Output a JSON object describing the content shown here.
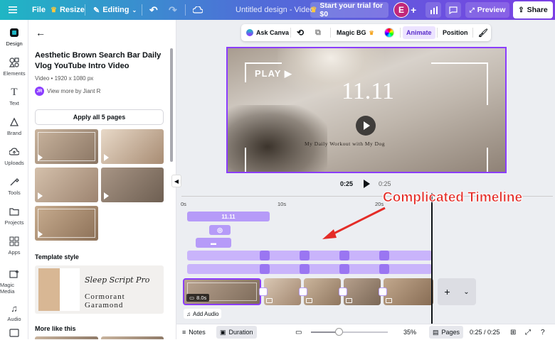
{
  "topbar": {
    "file": "File",
    "resize": "Resize",
    "editing": "Editing",
    "doc_title": "Untitled design - Video",
    "trial": "Start your trial for $0",
    "avatar_initial": "E",
    "preview": "Preview",
    "share": "Share"
  },
  "rail": {
    "items": [
      {
        "label": "Design",
        "icon": "design-icon"
      },
      {
        "label": "Elements",
        "icon": "elements-icon"
      },
      {
        "label": "Text",
        "icon": "text-icon"
      },
      {
        "label": "Brand",
        "icon": "brand-icon"
      },
      {
        "label": "Uploads",
        "icon": "uploads-icon"
      },
      {
        "label": "Tools",
        "icon": "tools-icon"
      },
      {
        "label": "Projects",
        "icon": "projects-icon"
      },
      {
        "label": "Apps",
        "icon": "apps-icon"
      },
      {
        "label": "Magic Media",
        "icon": "magic-media-icon"
      },
      {
        "label": "Audio",
        "icon": "audio-icon"
      },
      {
        "label": "Videos",
        "icon": "videos-icon"
      }
    ]
  },
  "panel": {
    "title": "Aesthetic Brown Search Bar Daily Vlog YouTube Intro Video",
    "meta": "Video • 1920 x 1080 px",
    "author_initials": "JR",
    "author": "View more by Jiant R",
    "apply": "Apply all 5 pages",
    "template_style": "Template style",
    "font1": "Sleep Script Pro",
    "font2": "Cormorant Garamond",
    "more_like": "More like this"
  },
  "context_toolbar": {
    "ask_canva": "Ask Canva",
    "magic_bg": "Magic BG",
    "animate": "Animate",
    "position": "Position"
  },
  "video": {
    "play_label": "PLAY ▶",
    "title": "11.11",
    "subtitle": "My Daily Workout with My Dog"
  },
  "playback": {
    "current": "0:25",
    "total": "0:25"
  },
  "timeline": {
    "ticks": [
      "0s",
      "10s",
      "20s"
    ],
    "track1_label": "11.11",
    "clip1_duration": "8.0s",
    "add_audio": "Add Audio"
  },
  "annotation": "Complicated Timeline",
  "bottombar": {
    "notes": "Notes",
    "duration": "Duration",
    "zoom": "35%",
    "zoom_level": 0.35,
    "pages": "Pages",
    "time": "0:25 / 0:25"
  },
  "colors": {
    "accent": "#8b3dff",
    "track": "#b69bf8",
    "annotation": "#e42c27"
  }
}
